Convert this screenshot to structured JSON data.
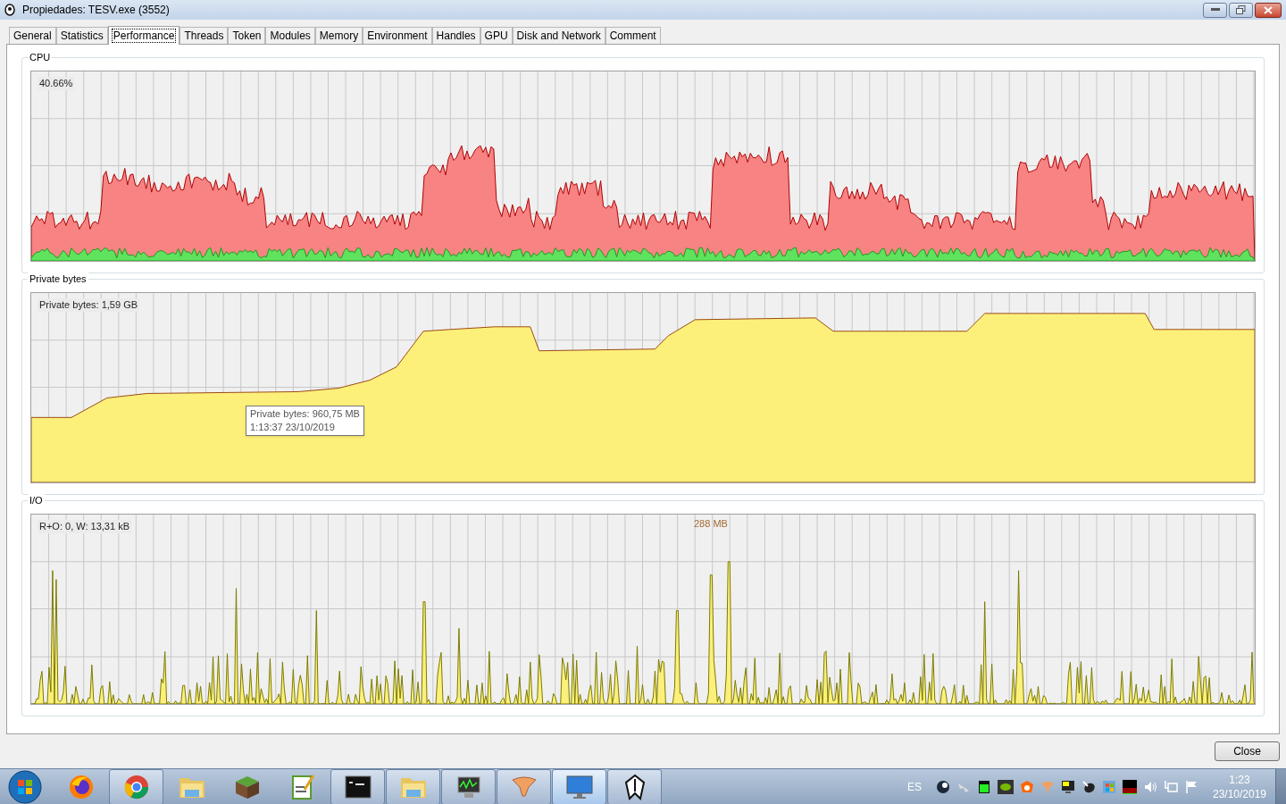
{
  "window": {
    "title": "Propiedades: TESV.exe (3552)"
  },
  "tabs": [
    {
      "label": "General",
      "selected": false
    },
    {
      "label": "Statistics",
      "selected": false
    },
    {
      "label": "Performance",
      "selected": true
    },
    {
      "label": "Threads",
      "selected": false
    },
    {
      "label": "Token",
      "selected": false
    },
    {
      "label": "Modules",
      "selected": false
    },
    {
      "label": "Memory",
      "selected": false
    },
    {
      "label": "Environment",
      "selected": false
    },
    {
      "label": "Handles",
      "selected": false
    },
    {
      "label": "GPU",
      "selected": false
    },
    {
      "label": "Disk and Network",
      "selected": false
    },
    {
      "label": "Comment",
      "selected": false
    }
  ],
  "sections": [
    {
      "kind": "cpu",
      "title": "CPU",
      "reading": "40.66%"
    },
    {
      "kind": "memory",
      "title": "Private bytes",
      "reading": "Private bytes: 1,59 GB",
      "tooltip": {
        "line_1": "Private bytes: 960,75 MB",
        "line_2": "1:13:37 23/10/2019"
      }
    },
    {
      "kind": "io",
      "title": "I/O",
      "reading": "R+O: 0, W: 13,31 kB",
      "peak_label": "288 MB"
    }
  ],
  "buttons": [
    "Close"
  ],
  "taskbar": {
    "apps": [
      {
        "kind": "firefox",
        "running": false,
        "selected": false
      },
      {
        "kind": "chrome",
        "running": true,
        "selected": false
      },
      {
        "kind": "folder",
        "running": false,
        "selected": false
      },
      {
        "kind": "grass",
        "running": false,
        "selected": false
      },
      {
        "kind": "notepad",
        "running": false,
        "selected": false
      },
      {
        "kind": "terminal",
        "running": true,
        "selected": false
      },
      {
        "kind": "folder",
        "running": true,
        "selected": false
      },
      {
        "kind": "monitor",
        "running": true,
        "selected": false
      },
      {
        "kind": "tornado",
        "running": true,
        "selected": false
      },
      {
        "kind": "screen",
        "running": true,
        "selected": true
      },
      {
        "kind": "emblem",
        "running": true,
        "selected": false
      }
    ],
    "language": "ES",
    "time": "1:23",
    "date": "23/10/2019"
  }
}
